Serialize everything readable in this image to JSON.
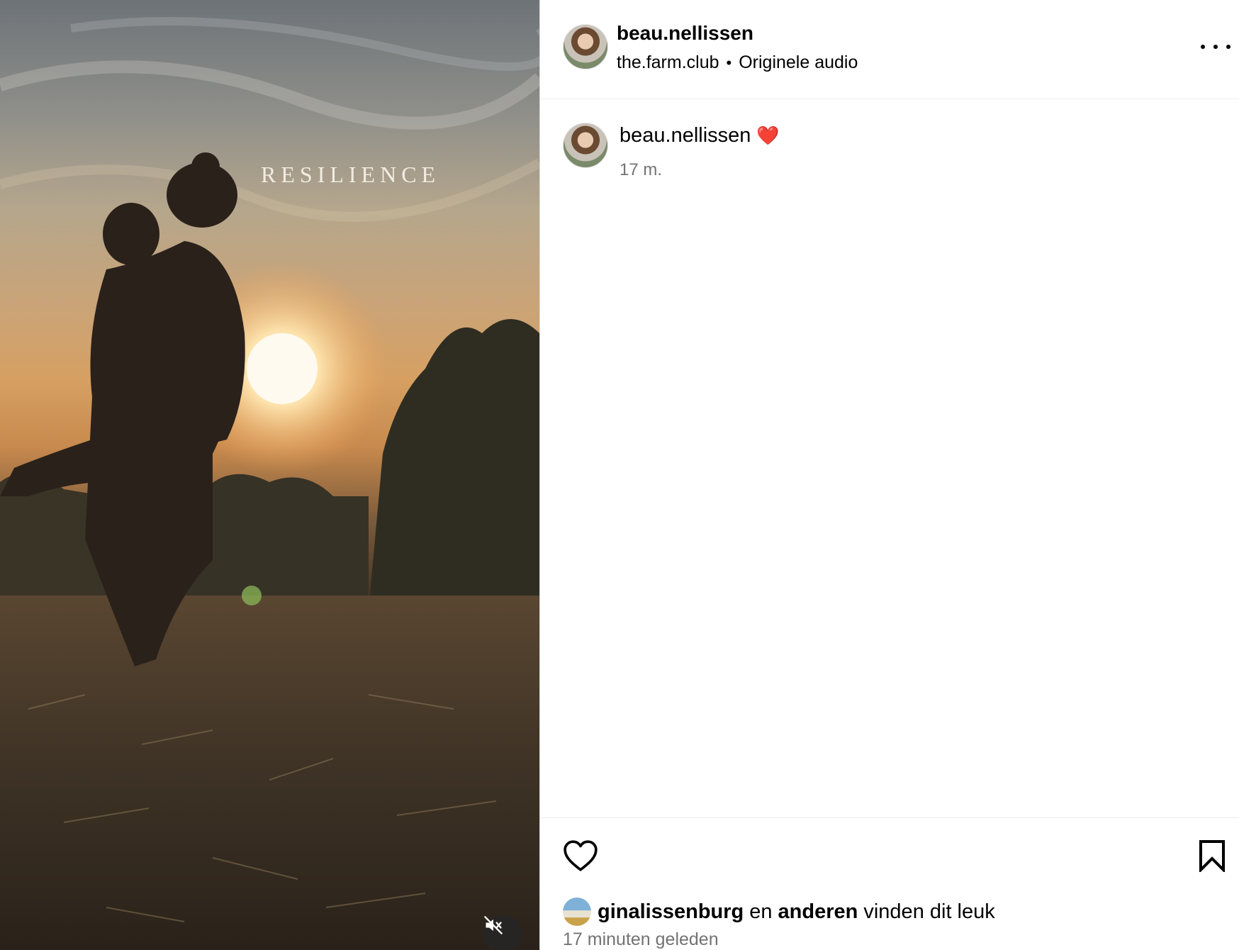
{
  "media": {
    "overlay_text": "RESILIENCE",
    "mute_icon": "speaker-muted-icon"
  },
  "header": {
    "username": "beau.nellissen",
    "subline_account": "the.farm.club",
    "subline_separator": "•",
    "subline_audio": "Originele audio",
    "more_icon": "more-options-icon"
  },
  "caption": {
    "username": "beau.nellissen",
    "emoji": "❤️",
    "time": "17 m."
  },
  "actions": {
    "like_icon": "heart-icon",
    "save_icon": "bookmark-icon",
    "liked_by_user": "ginalissenburg",
    "liked_by_connector": "en",
    "liked_by_others": "anderen",
    "liked_by_suffix": "vinden dit leuk",
    "time_ago": "17 minuten geleden"
  },
  "colors": {
    "secondary_text": "#737373",
    "divider": "#efefef",
    "heart_emoji": "#d0202e"
  }
}
